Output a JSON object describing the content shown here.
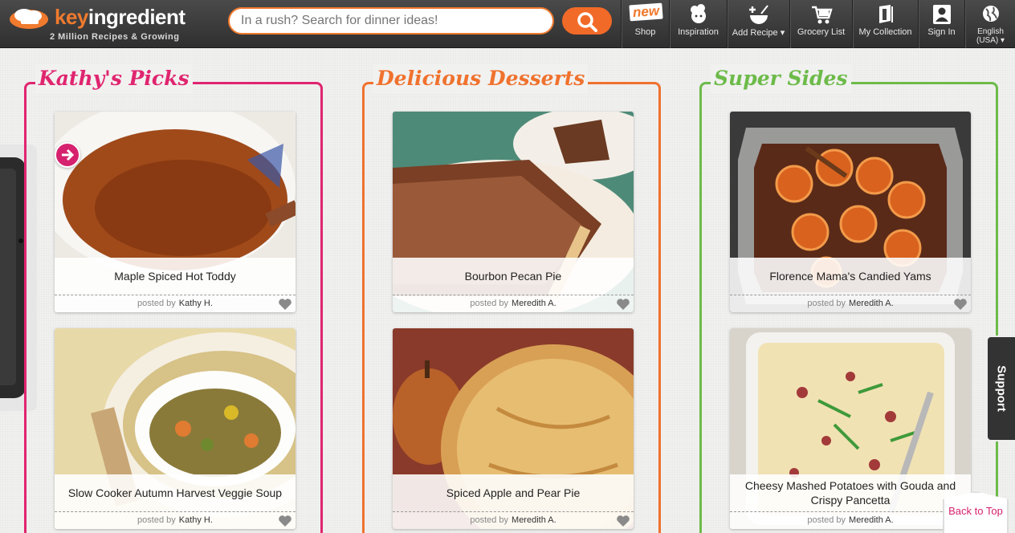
{
  "header": {
    "logo_key": "key",
    "logo_ingredient": "ingredient",
    "tagline": "2 Million Recipes & Growing",
    "search_placeholder": "In a rush? Search for dinner ideas!",
    "nav": {
      "new_badge": "new",
      "shop": "Shop",
      "inspiration": "Inspiration",
      "add_recipe": "Add Recipe ▾",
      "grocery_list": "Grocery List",
      "my_collection": "My Collection",
      "sign_in": "Sign In",
      "language_line1": "English",
      "language_line2": "(USA) ▾"
    }
  },
  "columns": [
    {
      "title": "Kathy's Picks",
      "color": "#e0256f",
      "cards": [
        {
          "title": "Maple Spiced Hot Toddy",
          "posted_by": "posted by",
          "author": "Kathy H."
        },
        {
          "title": "Slow Cooker Autumn Harvest Veggie Soup",
          "posted_by": "posted by",
          "author": "Kathy H."
        }
      ]
    },
    {
      "title": "Delicious Desserts",
      "color": "#f0722e",
      "cards": [
        {
          "title": "Bourbon Pecan Pie",
          "posted_by": "posted by",
          "author": "Meredith A."
        },
        {
          "title": "Spiced Apple and Pear Pie",
          "posted_by": "posted by",
          "author": "Meredith A."
        }
      ]
    },
    {
      "title": "Super Sides",
      "color": "#6dbb4a",
      "cards": [
        {
          "title": "Florence Mama's Candied Yams",
          "posted_by": "posted by",
          "author": "Meredith A."
        },
        {
          "title": "Cheesy Mashed Potatoes with Gouda and Crispy Pancetta",
          "posted_by": "posted by",
          "author": "Meredith A."
        }
      ]
    }
  ],
  "support_label": "Support",
  "back_to_top": "Back to Top",
  "icons": [
    "heart-icon",
    "arrow-right-icon",
    "search-icon",
    "chef-icon",
    "bowl-plus-icon",
    "cart-icon",
    "book-icon",
    "person-icon",
    "globe-icon"
  ]
}
